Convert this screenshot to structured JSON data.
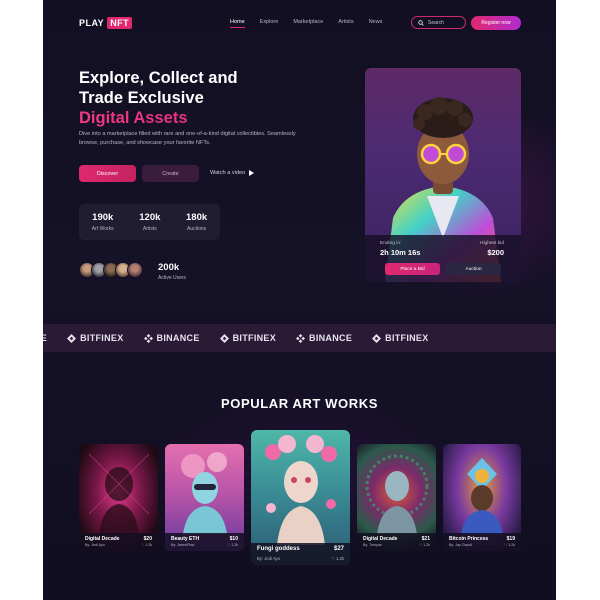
{
  "brand": {
    "play": "PLAY",
    "nft": "NFT"
  },
  "nav": {
    "items": [
      "Home",
      "Explore",
      "Marketplace",
      "Artists",
      "News"
    ],
    "active": "Home"
  },
  "search": {
    "placeholder": "Search"
  },
  "register_label": "Register now",
  "hero": {
    "title_line1": "Explore, Collect and",
    "title_line2": "Trade Exclusive",
    "title_accent": "Digital Assets",
    "description": "Dive into a marketplace filled with rare and one-of-a-kind digital collectibles. Seamlessly browse, purchase, and showcase your favorite NFTs.",
    "discover_label": "Discover",
    "create_label": "Create",
    "watch_label": "Watch a video",
    "stats": [
      {
        "value": "190k",
        "label": "Art Works"
      },
      {
        "value": "120k",
        "label": "Artists"
      },
      {
        "value": "180k",
        "label": "Auctions"
      }
    ],
    "users_value": "200k",
    "users_label": "Active Users"
  },
  "featured": {
    "ending_label": "Ending in:",
    "ending_value": "2h 10m 16s",
    "bid_label": "Highest bid",
    "bid_value": "$200",
    "place_bid_label": "Place a Bid",
    "auction_label": "Auction"
  },
  "partners": {
    "items": [
      "CE",
      "BITFINEX",
      "BINANCE",
      "BITFINEX",
      "BINANCE",
      "BITFINEX"
    ]
  },
  "popular": {
    "title": "POPULAR ART WORKS",
    "items": [
      {
        "name": "Digital Decade",
        "by": "By: Jedi Ayo",
        "price": "$20",
        "likes": "♡ 1.2k"
      },
      {
        "name": "Beauty ETH",
        "by": "By: JanesFlow",
        "price": "$10",
        "likes": "♡ 1.2k"
      },
      {
        "name": "Fungi goddess",
        "by": "By: Jedi Ayo",
        "price": "$27",
        "likes": "♡ 1.2k"
      },
      {
        "name": "Digital Decade",
        "by": "By: Tomyao",
        "price": "$21",
        "likes": "♡ 1.2k"
      },
      {
        "name": "Bitcoin Princess",
        "by": "By: Jay Claudi",
        "price": "$19",
        "likes": "♡ 1.2k"
      }
    ]
  },
  "colors": {
    "accent": "#e0286e",
    "background": "#151127",
    "band": "#2b1a35"
  }
}
